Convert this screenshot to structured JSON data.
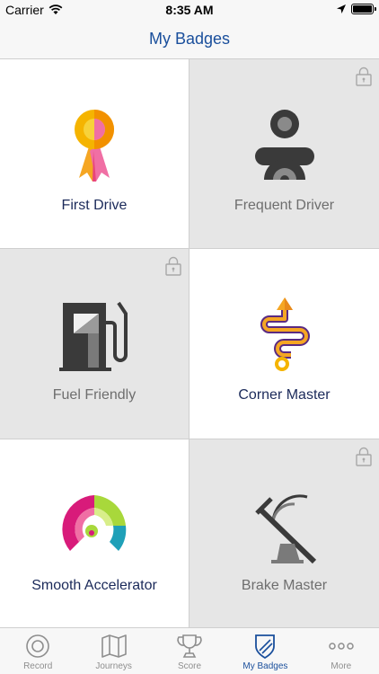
{
  "status_bar": {
    "carrier": "Carrier",
    "time": "8:35 AM"
  },
  "nav": {
    "title": "My Badges"
  },
  "badges": [
    {
      "label": "First Drive",
      "locked": false,
      "icon": "ribbon-icon"
    },
    {
      "label": "Frequent Driver",
      "locked": true,
      "icon": "driver-icon"
    },
    {
      "label": "Fuel Friendly",
      "locked": true,
      "icon": "fuel-pump-icon"
    },
    {
      "label": "Corner Master",
      "locked": false,
      "icon": "winding-road-icon"
    },
    {
      "label": "Smooth Accelerator",
      "locked": false,
      "icon": "speedometer-icon"
    },
    {
      "label": "Brake Master",
      "locked": true,
      "icon": "brake-pedal-icon"
    }
  ],
  "tabs": [
    {
      "label": "Record",
      "icon": "record-icon",
      "active": false
    },
    {
      "label": "Journeys",
      "icon": "map-icon",
      "active": false
    },
    {
      "label": "Score",
      "icon": "trophy-icon",
      "active": false
    },
    {
      "label": "My Badges",
      "icon": "shield-icon",
      "active": true
    },
    {
      "label": "More",
      "icon": "more-dots-icon",
      "active": false
    }
  ],
  "colors": {
    "accent": "#1a4f9c",
    "label_unlocked": "#1b2a5a",
    "label_locked": "#6e6e6e",
    "locked_bg": "#e6e6e6"
  }
}
